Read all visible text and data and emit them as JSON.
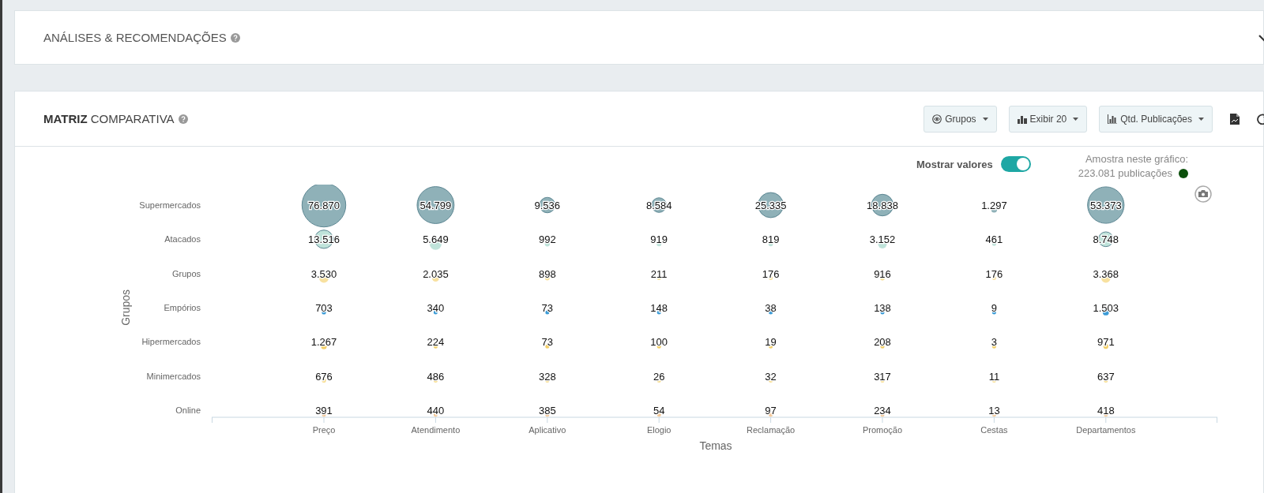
{
  "analyses_panel": {
    "title": "ANÁLISES & RECOMENDAÇÕES",
    "expanded": false
  },
  "matrix_panel": {
    "title": "**MATRIZ** COMPARATIVA",
    "toolbar": [
      {
        "kind": "eye",
        "label": "Grupos"
      },
      {
        "kind": "chart",
        "label": "Exibir 20"
      },
      {
        "kind": "bars",
        "label": "Qtd. Publicações"
      }
    ],
    "show_values": {
      "label": "Mostrar valores",
      "on": true
    },
    "sample": {
      "label": "Amostra neste gráfico:",
      "value": "223.081 publicações",
      "color": "#0b4f0b"
    },
    "matrix": {
      "y_title": "Grupos",
      "rows": [
        {
          "label": "Supermercados",
          "color": "#8fb1b8",
          "cells": [
            "76.870",
            "54.799",
            "9.536",
            "8.584",
            "25.335",
            "18.838",
            "1.297",
            "53.373"
          ]
        },
        {
          "label": "Atacados",
          "color": "#bfe3da",
          "cells": [
            "13.516",
            "5.649",
            "992",
            "919",
            "819",
            "3.152",
            "461",
            "8.748"
          ]
        },
        {
          "label": "Grupos",
          "color": "#f8e1a0",
          "cells": [
            "3.530",
            "2.035",
            "898",
            "211",
            "176",
            "916",
            "176",
            "3.368"
          ]
        },
        {
          "label": "Empórios",
          "color": "#3b9bd6",
          "cells": [
            "703",
            "340",
            "73",
            "148",
            "38",
            "138",
            "9",
            "1.503"
          ]
        },
        {
          "label": "Hipermercados",
          "color": "#f3cf6a",
          "cells": [
            "1.267",
            "224",
            "73",
            "100",
            "19",
            "208",
            "3",
            "971"
          ]
        },
        {
          "label": "Minimercados",
          "color": "#f6dc8e",
          "cells": [
            "676",
            "486",
            "328",
            "26",
            "32",
            "317",
            "11",
            "637"
          ]
        },
        {
          "label": "Online",
          "color": "#f4c99a",
          "cells": [
            "391",
            "440",
            "385",
            "54",
            "97",
            "234",
            "13",
            "418"
          ]
        }
      ],
      "x_axis": {
        "labels": [
          "Preço",
          "Atendimento",
          "Aplicativo",
          "Elogio",
          "Reclamação",
          "Promoção",
          "Cestas",
          "Departamentos"
        ],
        "title": "Temas"
      }
    }
  }
}
